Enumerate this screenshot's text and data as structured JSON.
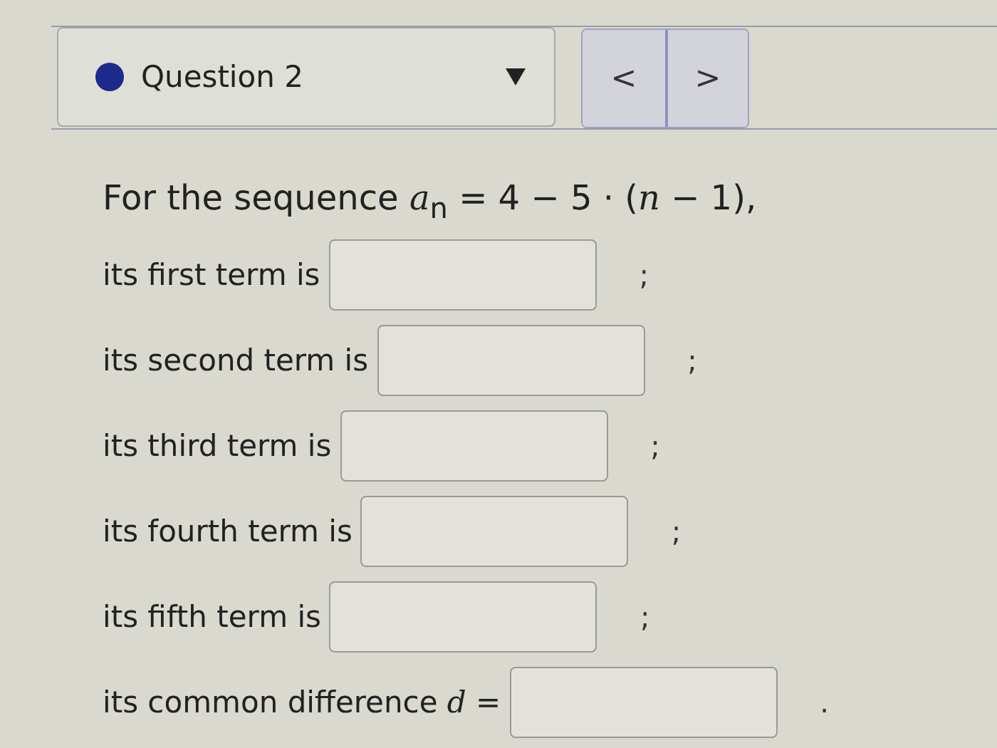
{
  "question_selector": {
    "label": "Question 2"
  },
  "nav_buttons": [
    "<",
    ">"
  ],
  "prompt": "For the sequence *a*$_{n}$ = 4 − 5 · (*n* − 1),",
  "answers": [
    {
      "label": "its first term is",
      "suffix": ";"
    },
    {
      "label": "its second term is",
      "suffix": ";"
    },
    {
      "label": "its third term is",
      "suffix": ";"
    },
    {
      "label": "its fourth term is",
      "suffix": ";"
    },
    {
      "label": "its fifth term is",
      "suffix": ";"
    },
    {
      "label": "its common difference *d* =",
      "suffix": "."
    }
  ]
}
